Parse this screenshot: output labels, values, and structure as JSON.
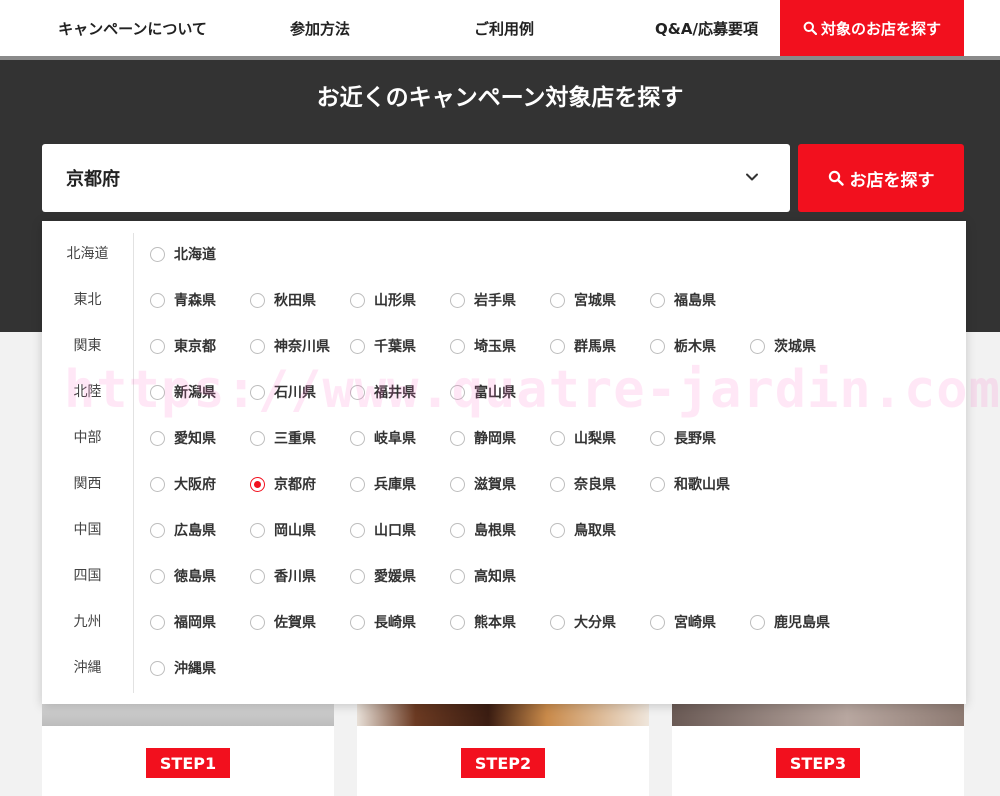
{
  "nav": {
    "items": [
      "キャンペーンについて",
      "参加方法",
      "ご利用例",
      "Q&A/応募要項"
    ],
    "search_label": "対象のお店を探す"
  },
  "band": {
    "title": "お近くのキャンペーン対象店を探す",
    "select_value": "京都府",
    "find_button": "お店を探す"
  },
  "regions": [
    {
      "name": "北海道",
      "prefs": [
        "北海道"
      ]
    },
    {
      "name": "東北",
      "prefs": [
        "青森県",
        "秋田県",
        "山形県",
        "岩手県",
        "宮城県",
        "福島県"
      ]
    },
    {
      "name": "関東",
      "prefs": [
        "東京都",
        "神奈川県",
        "千葉県",
        "埼玉県",
        "群馬県",
        "栃木県",
        "茨城県"
      ]
    },
    {
      "name": "北陸",
      "prefs": [
        "新潟県",
        "石川県",
        "福井県",
        "富山県"
      ]
    },
    {
      "name": "中部",
      "prefs": [
        "愛知県",
        "三重県",
        "岐阜県",
        "静岡県",
        "山梨県",
        "長野県"
      ]
    },
    {
      "name": "関西",
      "prefs": [
        "大阪府",
        "京都府",
        "兵庫県",
        "滋賀県",
        "奈良県",
        "和歌山県"
      ]
    },
    {
      "name": "中国",
      "prefs": [
        "広島県",
        "岡山県",
        "山口県",
        "島根県",
        "鳥取県"
      ]
    },
    {
      "name": "四国",
      "prefs": [
        "徳島県",
        "香川県",
        "愛媛県",
        "高知県"
      ]
    },
    {
      "name": "九州",
      "prefs": [
        "福岡県",
        "佐賀県",
        "長崎県",
        "熊本県",
        "大分県",
        "宮崎県",
        "鹿児島県"
      ]
    },
    {
      "name": "沖縄",
      "prefs": [
        "沖縄県"
      ]
    }
  ],
  "selected_pref": "京都府",
  "steps": [
    "STEP1",
    "STEP2",
    "STEP3"
  ],
  "watermark": "https://www.quatre-jardin.com",
  "colors": {
    "accent": "#f2101e",
    "band": "#333333"
  },
  "icons": {
    "search": "search-icon",
    "chevron": "chevron-down-icon",
    "radio": "radio-icon"
  }
}
